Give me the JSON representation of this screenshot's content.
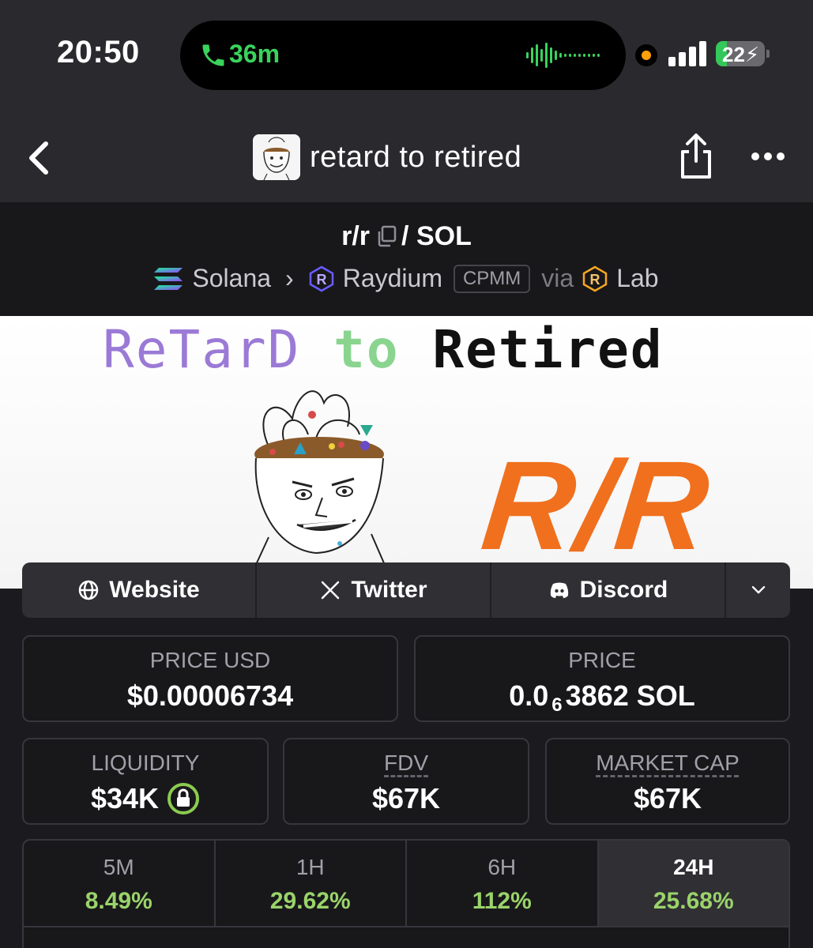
{
  "status_bar": {
    "time": "20:50",
    "call_duration": "36m",
    "battery_percent": 22,
    "battery_label": "22",
    "colors": {
      "call_green": "#3ad35c",
      "battery_green": "#34c759",
      "privacy_dot": "#ff9f0a"
    }
  },
  "nav": {
    "back_icon": "chevron-left-icon",
    "title": "retard to retired",
    "share_icon": "share-icon",
    "more_icon": "ellipsis-icon"
  },
  "pair": {
    "symbol": "r/r",
    "separator": "/",
    "quote": "SOL",
    "chain": "Solana",
    "dex": "Raydium",
    "pool_type": "CPMM",
    "via_label": "via",
    "launchpad": "Lab"
  },
  "banner": {
    "word1": "ReTarD",
    "word2": "to",
    "word3": "Retired",
    "logo_text": "R/R",
    "colors": {
      "word1": "#9b7ad6",
      "word2": "#8ad48f",
      "word3": "#111111",
      "logo": "#f0701e"
    }
  },
  "links": {
    "website": "Website",
    "twitter": "Twitter",
    "discord": "Discord",
    "expand_icon": "chevron-down-icon"
  },
  "stats": {
    "price_usd_label": "PRICE USD",
    "price_usd_value": "$0.00006734",
    "price_label": "PRICE",
    "price_prefix": "0.0",
    "price_zeros": "6",
    "price_suffix": "3862 SOL",
    "liquidity_label": "LIQUIDITY",
    "liquidity_value": "$34K",
    "fdv_label": "FDV",
    "fdv_value": "$67K",
    "mcap_label": "MARKET CAP",
    "mcap_value": "$67K"
  },
  "timeframes": [
    {
      "label": "5M",
      "change": "8.49%"
    },
    {
      "label": "1H",
      "change": "29.62%"
    },
    {
      "label": "6H",
      "change": "112%"
    },
    {
      "label": "24H",
      "change": "25.68%"
    }
  ],
  "active_timeframe": "24H",
  "accent_colors": {
    "positive": "#9ad36a",
    "lock_green": "#8bcb4f"
  }
}
